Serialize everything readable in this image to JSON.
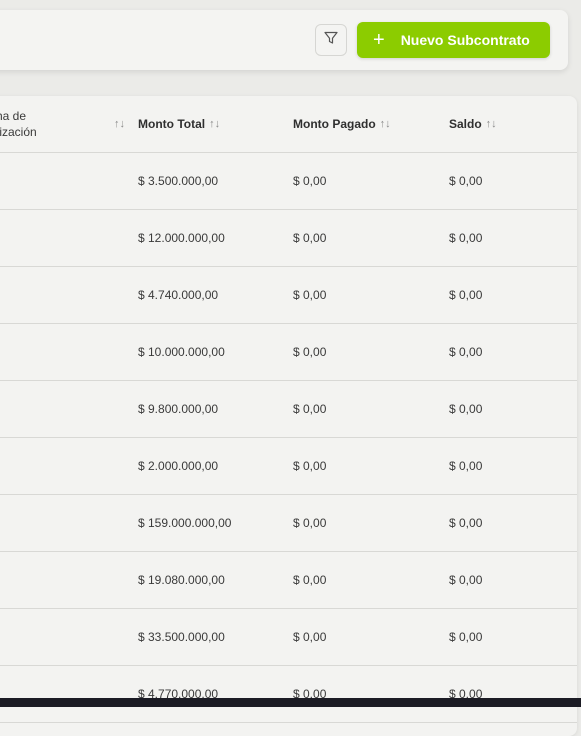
{
  "toolbar": {
    "new_button_label": "Nuevo Subcontrato",
    "new_button_plus": "+",
    "accent_color": "#8ccc00"
  },
  "table": {
    "columns": [
      {
        "key": "fecha",
        "label": "cha de\nalización"
      },
      {
        "key": "monto_total",
        "label": "Monto Total"
      },
      {
        "key": "monto_pagado",
        "label": "Monto Pagado"
      },
      {
        "key": "saldo",
        "label": "Saldo"
      }
    ],
    "sort_glyph": "↑↓",
    "rows": [
      {
        "monto_total": "$ 3.500.000,00",
        "monto_pagado": "$ 0,00",
        "saldo": "$ 0,00"
      },
      {
        "monto_total": "$ 12.000.000,00",
        "monto_pagado": "$ 0,00",
        "saldo": "$ 0,00"
      },
      {
        "monto_total": "$ 4.740.000,00",
        "monto_pagado": "$ 0,00",
        "saldo": "$ 0,00"
      },
      {
        "monto_total": "$ 10.000.000,00",
        "monto_pagado": "$ 0,00",
        "saldo": "$ 0,00"
      },
      {
        "monto_total": "$ 9.800.000,00",
        "monto_pagado": "$ 0,00",
        "saldo": "$ 0,00"
      },
      {
        "monto_total": "$ 2.000.000,00",
        "monto_pagado": "$ 0,00",
        "saldo": "$ 0,00"
      },
      {
        "monto_total": "$ 159.000.000,00",
        "monto_pagado": "$ 0,00",
        "saldo": "$ 0,00"
      },
      {
        "monto_total": "$ 19.080.000,00",
        "monto_pagado": "$ 0,00",
        "saldo": "$ 0,00"
      },
      {
        "monto_total": "$ 33.500.000,00",
        "monto_pagado": "$ 0,00",
        "saldo": "$ 0,00"
      },
      {
        "monto_total": "$ 4.770.000,00",
        "monto_pagado": "$ 0,00",
        "saldo": "$ 0,00"
      }
    ]
  }
}
